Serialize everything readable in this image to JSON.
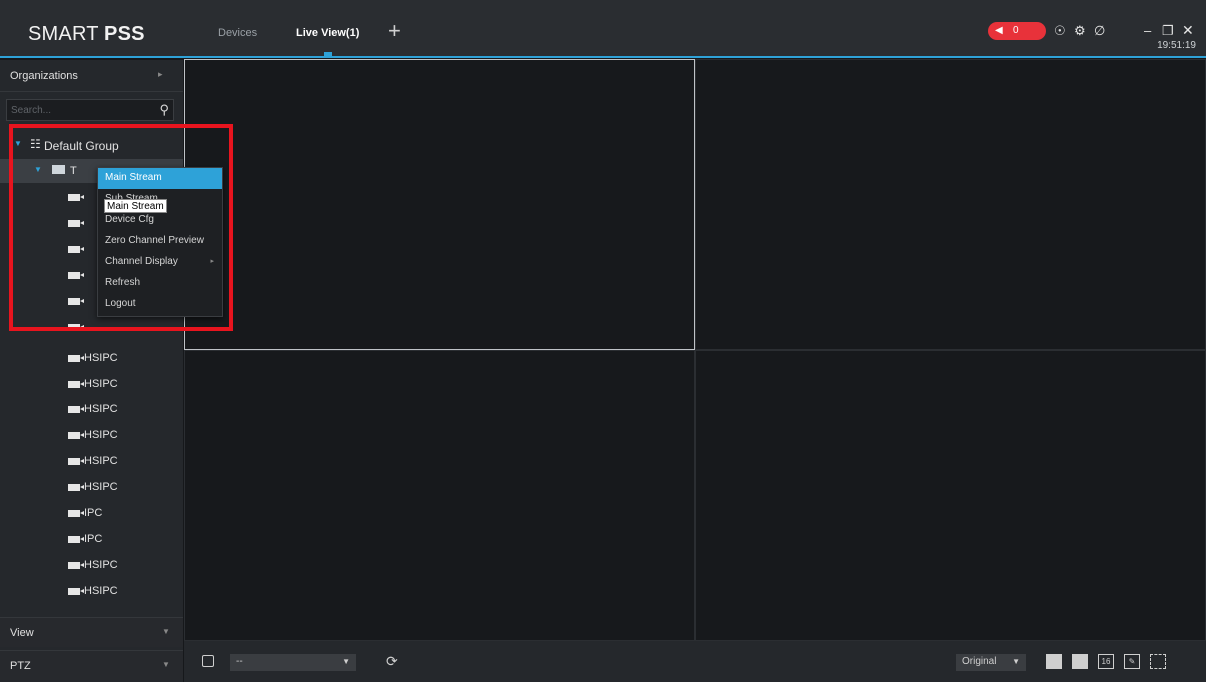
{
  "app": {
    "logo_light": "SMART ",
    "logo_bold": "PSS"
  },
  "tabs": [
    {
      "label": "Devices"
    },
    {
      "label": "Live View(1)"
    }
  ],
  "header": {
    "alarm_count": "0",
    "time": "19:51:19"
  },
  "sidebar": {
    "organizations_label": "Organizations",
    "search_placeholder": "Search...",
    "group_label": "Default Group",
    "device_label_visible": "T",
    "channels": [
      "HSIPC",
      "HSIPC",
      "HSIPC",
      "HSIPC",
      "HSIPC",
      "HSIPC",
      "IPC",
      "IPC",
      "HSIPC",
      "HSIPC"
    ],
    "view_label": "View",
    "ptz_label": "PTZ"
  },
  "context_menu": {
    "items": [
      "Main Stream",
      "Sub Stream",
      "Device Cfg",
      "Zero Channel Preview",
      "Channel Display",
      "Refresh",
      "Logout"
    ],
    "tooltip": "Main Stream"
  },
  "bottom_bar": {
    "stream_value": "--",
    "ratio_value": "Original",
    "layout_16_label": "16"
  },
  "colors": {
    "accent": "#2ea2d8",
    "alarm": "#e8323a",
    "annotation": "#e8141e"
  }
}
